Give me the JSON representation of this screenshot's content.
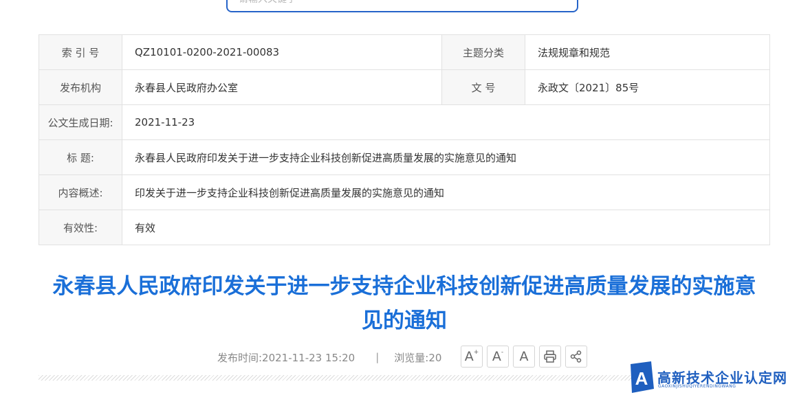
{
  "search": {
    "placeholder": "请输入关键字"
  },
  "meta": {
    "index_label": "索 引 号",
    "index_value": "QZ10101-0200-2021-00083",
    "topic_label": "主题分类",
    "topic_value": "法规规章和规范",
    "publisher_label": "发布机构",
    "publisher_value": "永春县人民政府办公室",
    "doc_no_label": "文 号",
    "doc_no_value": "永政文〔2021〕85号",
    "date_label": "公文生成日期:",
    "date_value": "2021-11-23",
    "title_label": "标 题:",
    "title_value": "永春县人民政府印发关于进一步支持企业科技创新促进高质量发展的实施意见的通知",
    "summary_label": "内容概述:",
    "summary_value": "印发关于进一步支持企业科技创新促进高质量发展的实施意见的通知",
    "validity_label": "有效性:",
    "validity_value": "有效"
  },
  "article": {
    "title_line1": "永春县人民政府印发关于进一步支持企业科技创新促进高质量发展的实施意",
    "title_line2": "见的通知",
    "publish_time": "发布时间:2021-11-23 15:20",
    "separator": "|",
    "views": "浏览量:20"
  },
  "tools": {
    "font_large": "A",
    "font_small": "A",
    "font_reset": "A",
    "plus": "+",
    "minus": "-"
  },
  "watermark": {
    "text": "高新技术企业认定网",
    "subtext": "GAOXINJISHUQIYERENDINGWANG",
    "logo_letter": "A"
  },
  "colors": {
    "accent": "#1a6fd8",
    "search_border": "#2563c9",
    "label_bg": "#f7f7f7",
    "border": "#e1e1e1"
  }
}
